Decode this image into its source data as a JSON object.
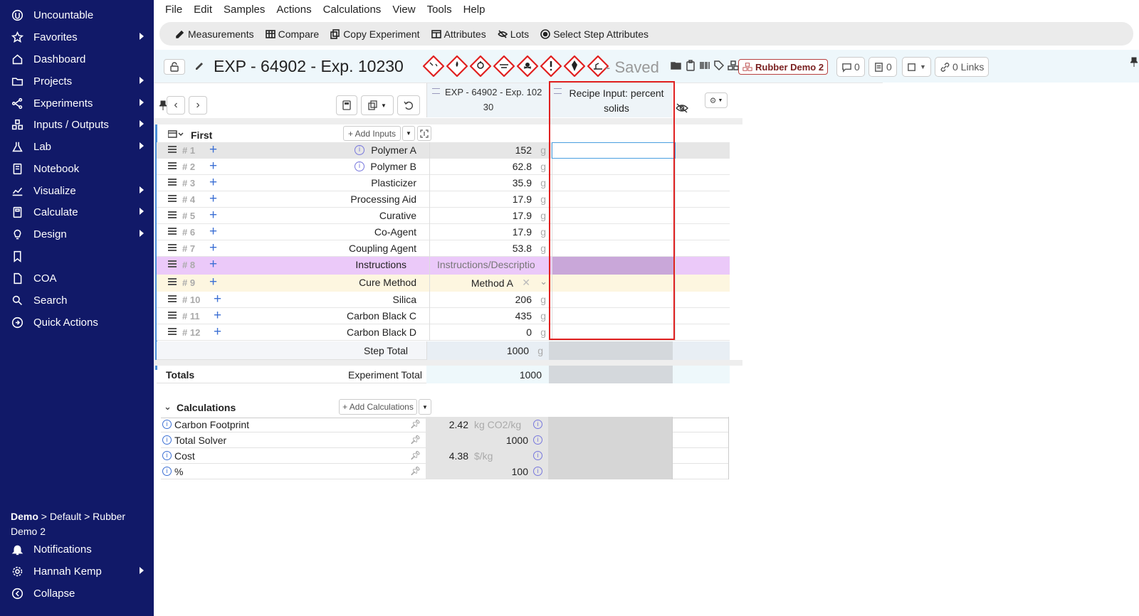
{
  "sidebar": {
    "items": [
      {
        "label": "Uncountable",
        "icon": "uncountable-logo-icon",
        "arrow": false
      },
      {
        "label": "Favorites",
        "icon": "star-icon",
        "arrow": true
      },
      {
        "label": "Dashboard",
        "icon": "home-icon",
        "arrow": false
      },
      {
        "label": "Projects",
        "icon": "folder-icon",
        "arrow": true
      },
      {
        "label": "Experiments",
        "icon": "network-icon",
        "arrow": true
      },
      {
        "label": "Inputs / Outputs",
        "icon": "cubes-icon",
        "arrow": true
      },
      {
        "label": "Lab",
        "icon": "flask-icon",
        "arrow": true
      },
      {
        "label": "Notebook",
        "icon": "notebook-icon",
        "arrow": false
      },
      {
        "label": "Visualize",
        "icon": "chart-icon",
        "arrow": true
      },
      {
        "label": "Calculate",
        "icon": "calculator-icon",
        "arrow": true
      },
      {
        "label": "Design",
        "icon": "lightbulb-icon",
        "arrow": true
      },
      {
        "label": "",
        "icon": "bookmark-icon",
        "arrow": false
      },
      {
        "label": "COA",
        "icon": "document-icon",
        "arrow": false
      },
      {
        "label": "Search",
        "icon": "search-icon",
        "arrow": false
      },
      {
        "label": "Quick Actions",
        "icon": "quick-actions-icon",
        "arrow": false
      }
    ],
    "breadcrumb_bold": "Demo",
    "breadcrumb_rest": " > Default > Rubber Demo 2",
    "notifications": "Notifications",
    "user": "Hannah Kemp",
    "collapse": "Collapse"
  },
  "menu": [
    "File",
    "Edit",
    "Samples",
    "Actions",
    "Calculations",
    "View",
    "Tools",
    "Help"
  ],
  "toolbar": [
    {
      "label": "Measurements",
      "icon": "pencil-icon"
    },
    {
      "label": "Compare",
      "icon": "table-icon"
    },
    {
      "label": "Copy Experiment",
      "icon": "copy-icon"
    },
    {
      "label": "Attributes",
      "icon": "attributes-icon"
    },
    {
      "label": "Lots",
      "icon": "eye-off-icon"
    },
    {
      "label": "Select Step Attributes",
      "icon": "radio-icon"
    }
  ],
  "header": {
    "title": "EXP - 64902 - Exp. 10230",
    "saved": "- Saved",
    "project_badge": "Rubber Demo 2",
    "comments": "0",
    "notes": "0",
    "links": "0 Links"
  },
  "columns": {
    "exp_col": "EXP - 64902 - Exp. 10230",
    "exp_col_line1": "EXP - 64902 - Exp. 102",
    "exp_col_line2": "30",
    "recipe_col": "Recipe Input: percent solids"
  },
  "step": {
    "name": "First",
    "add_inputs": "+ Add Inputs",
    "rows": [
      {
        "num": "# 1",
        "name": "Polymer A",
        "value": "152",
        "unit": "g",
        "info": true
      },
      {
        "num": "# 2",
        "name": "Polymer B",
        "value": "62.8",
        "unit": "g",
        "info": true
      },
      {
        "num": "# 3",
        "name": "Plasticizer",
        "value": "35.9",
        "unit": "g",
        "info": false
      },
      {
        "num": "# 4",
        "name": "Processing Aid",
        "value": "17.9",
        "unit": "g",
        "info": false
      },
      {
        "num": "# 5",
        "name": "Curative",
        "value": "17.9",
        "unit": "g",
        "info": false
      },
      {
        "num": "# 6",
        "name": "Co-Agent",
        "value": "17.9",
        "unit": "g",
        "info": false
      },
      {
        "num": "# 7",
        "name": "Coupling Agent",
        "value": "53.8",
        "unit": "g",
        "info": false
      },
      {
        "num": "# 8",
        "name": "Instructions",
        "value": "Instructions/Descriptio",
        "unit": "",
        "info": false,
        "type": "instructions"
      },
      {
        "num": "# 9",
        "name": "Cure Method",
        "value": "Method A",
        "unit": "",
        "info": false,
        "type": "select"
      },
      {
        "num": "# 10",
        "name": "Silica",
        "value": "206",
        "unit": "g",
        "info": false
      },
      {
        "num": "# 11",
        "name": "Carbon Black C",
        "value": "435",
        "unit": "g",
        "info": false
      },
      {
        "num": "# 12",
        "name": "Carbon Black D",
        "value": "0",
        "unit": "g",
        "info": false
      }
    ],
    "step_total_label": "Step Total",
    "step_total_value": "1000",
    "step_total_unit": "g"
  },
  "totals": {
    "label": "Totals",
    "experiment_total_label": "Experiment Total",
    "experiment_total_value": "1000"
  },
  "calculations": {
    "title": "Calculations",
    "add_label": "+ Add Calculations",
    "rows": [
      {
        "name": "Carbon Footprint",
        "value": "2.42",
        "unit": "kg CO2/kg"
      },
      {
        "name": "Total Solver",
        "value": "1000",
        "unit": ""
      },
      {
        "name": "Cost",
        "value": "4.38",
        "unit": "$/kg"
      },
      {
        "name": "%",
        "value": "100",
        "unit": ""
      }
    ]
  },
  "colors": {
    "sidebar_bg": "#111968",
    "highlight_border": "#e02020",
    "instructions_row": "#ebc9f9",
    "cure_row": "#fdf6e0",
    "accent_blue": "#3b6fd4"
  }
}
